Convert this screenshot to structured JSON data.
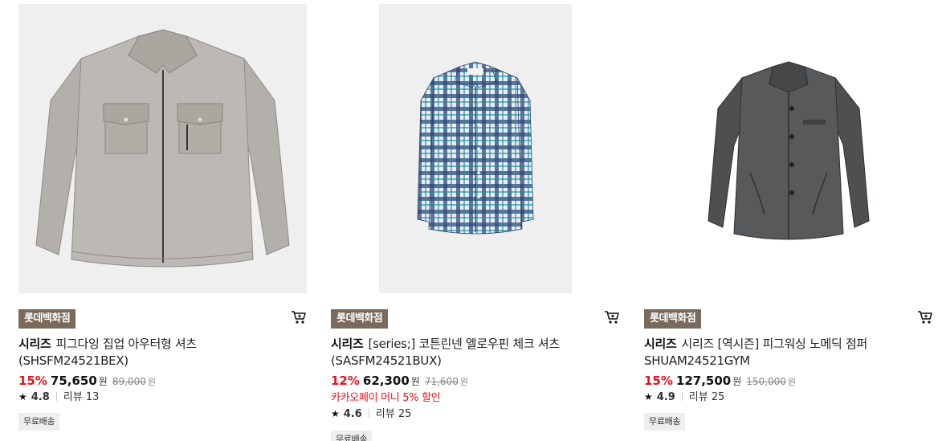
{
  "products": [
    {
      "store": "롯데백화점",
      "brand": "시리즈",
      "name_line1": "피그다잉 집업 아우터형 셔츠",
      "name_line2": "(SHSFM24521BEX)",
      "discount": "15%",
      "price": "75,650",
      "currency": "원",
      "original_price": "89,000",
      "promo": "",
      "rating": "4.8",
      "review_label": "리뷰 13",
      "shipping": "무료배송",
      "image_icon": "gray-zip-shirt-jacket"
    },
    {
      "store": "롯데백화점",
      "brand": "시리즈",
      "name_line1": "[series;] 코튼린넨 엘로우핀 체크 셔츠",
      "name_line2": "(SASFM24521BUX)",
      "discount": "12%",
      "price": "62,300",
      "currency": "원",
      "original_price": "71,600",
      "promo": "카카오페이 머니 5% 할인",
      "rating": "4.6",
      "review_label": "리뷰 25",
      "shipping": "무료배송",
      "image_icon": "blue-check-shirt"
    },
    {
      "store": "롯데백화점",
      "brand": "시리즈",
      "name_line1": "시리즈 [역시즌] 피그워싱 노메딕 점퍼",
      "name_line2": "SHUAM24521GYM",
      "discount": "15%",
      "price": "127,500",
      "currency": "원",
      "original_price": "150,000",
      "promo": "",
      "rating": "4.9",
      "review_label": "리뷰 25",
      "shipping": "무료배송",
      "image_icon": "charcoal-jumper"
    }
  ],
  "colors": {
    "store_badge": "#7a6a5c",
    "discount": "#e8121b",
    "image_bg": "#efefef"
  }
}
